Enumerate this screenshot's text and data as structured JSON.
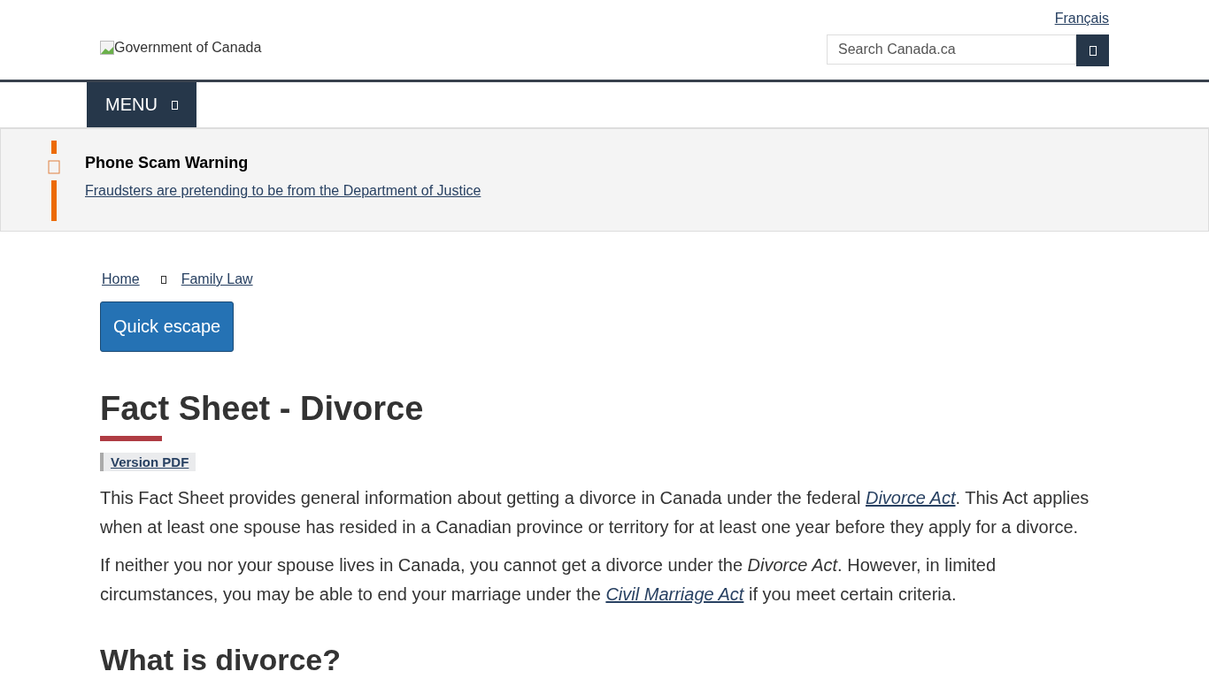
{
  "header": {
    "language_link": "Français",
    "logo_alt": "Government of Canada",
    "search": {
      "placeholder": "Search Canada.ca"
    }
  },
  "menu_button": "MENU",
  "alert": {
    "title": "Phone Scam Warning",
    "link": "Fraudsters are pretending to be from the Department of Justice"
  },
  "breadcrumb": [
    "Home",
    "Family Law"
  ],
  "quick_escape": "Quick escape",
  "title": "Fact Sheet - Divorce",
  "pdf_link": "Version PDF",
  "paragraphs": [
    [
      {
        "kind": "text",
        "text": "This Fact Sheet provides general information about getting a divorce in Canada under the federal "
      },
      {
        "kind": "link",
        "text": "Divorce Act"
      },
      {
        "kind": "text",
        "text": ". This Act applies when at least one spouse has resided in a Canadian province or territory for at least one year before they apply for a divorce."
      }
    ],
    [
      {
        "kind": "text",
        "text": "If neither you nor your spouse lives in Canada, you cannot get a divorce under the "
      },
      {
        "kind": "em",
        "text": "Divorce Act"
      },
      {
        "kind": "text",
        "text": ". However, in limited circumstances, you may be able to end your marriage under the "
      },
      {
        "kind": "link",
        "text": "Civil Marriage Act"
      },
      {
        "kind": "text",
        "text": " if you meet certain criteria."
      }
    ]
  ],
  "subheading": "What is divorce?"
}
